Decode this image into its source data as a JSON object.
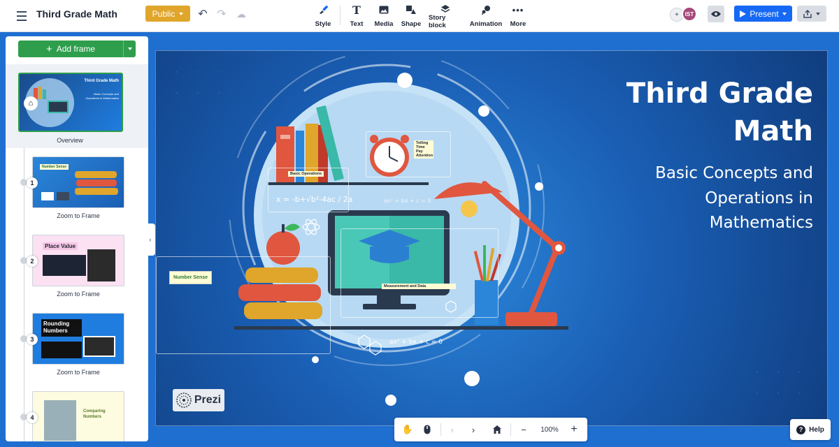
{
  "header": {
    "title": "Third Grade Math",
    "visibility_label": "Public",
    "tools": [
      {
        "label": "Style",
        "icon": "brush-icon"
      },
      {
        "label": "Text",
        "icon": "text-icon"
      },
      {
        "label": "Media",
        "icon": "image-icon"
      },
      {
        "label": "Shape",
        "icon": "shape-icon"
      },
      {
        "label": "Story block",
        "icon": "layers-icon"
      },
      {
        "label": "Animation",
        "icon": "sparkle-icon"
      },
      {
        "label": "More",
        "icon": "more-icon"
      }
    ],
    "avatar_initials": "IST",
    "present_label": "Present",
    "accent_color": "#1669f4",
    "public_color": "#e0a52b"
  },
  "sidebar": {
    "add_frame_label": "Add frame",
    "overview": {
      "label": "Overview",
      "thumb_title": "Third Grade Math",
      "thumb_subtitle": "Basic Concepts and Operations in Mathematics"
    },
    "frames": [
      {
        "number": "1",
        "caption": "Zoom to Frame",
        "thumb_title": "Number Sense"
      },
      {
        "number": "2",
        "caption": "Zoom to Frame",
        "thumb_title": "Place Value"
      },
      {
        "number": "3",
        "caption": "Zoom to Frame",
        "thumb_title": "Rounding Numbers"
      },
      {
        "number": "4",
        "caption": "",
        "thumb_title": "Comparing Numbers"
      }
    ]
  },
  "canvas": {
    "title": "Third Grade Math",
    "subtitle": "Basic Concepts and Operations in Mathematics",
    "formula_quadratic": "x = -b+√b²-4ac / 2a",
    "formula_1": "ax² + bx + c = 0",
    "formula_2": "ax² + bx + c = 0",
    "frames": {
      "number_sense": "Number Sense",
      "measurement": "Measurement and Data",
      "time": "Telling Time Pay Attention",
      "operations": "Basic Operations"
    },
    "logo_text": "Prezi"
  },
  "navbar": {
    "zoom": "100%"
  },
  "help_label": "Help"
}
